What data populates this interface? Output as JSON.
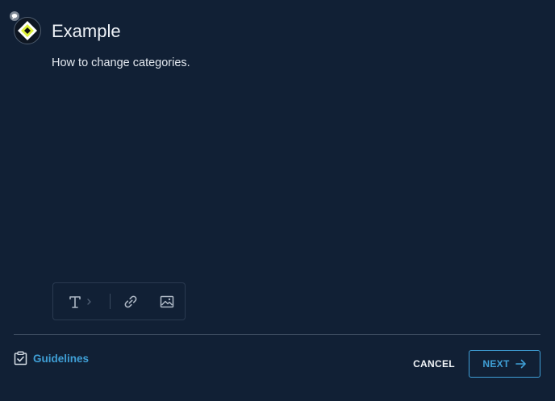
{
  "post": {
    "title": "Example",
    "body": "How to change categories."
  },
  "editor_toolbar": {
    "tools": [
      {
        "name": "text-format",
        "icon": "text-format-icon"
      },
      {
        "name": "link",
        "icon": "link-icon"
      },
      {
        "name": "image",
        "icon": "image-icon"
      }
    ]
  },
  "footer": {
    "guidelines_label": "Guidelines",
    "cancel_label": "CANCEL",
    "next_label": "NEXT"
  },
  "colors": {
    "background": "#112035",
    "accent": "#3f9fd6",
    "logo_yellow": "#dff23a"
  }
}
